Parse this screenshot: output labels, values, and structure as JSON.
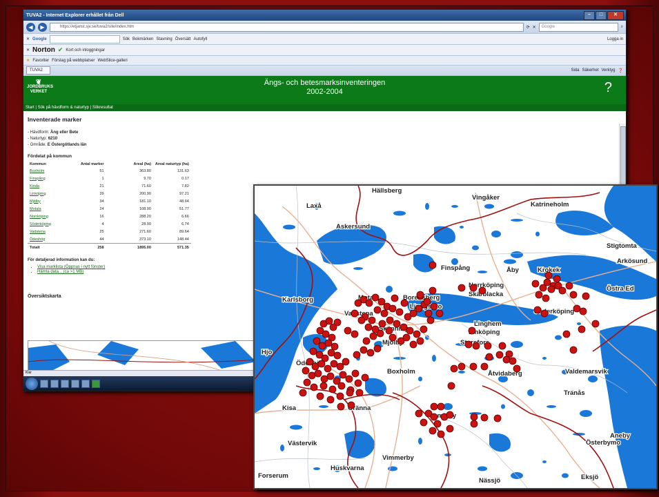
{
  "browser": {
    "window_title": "TUVA2 - Internet Explorer erhållet från Dell",
    "address": "https://etjanst.sjv.se/tuva2/site/index.htm",
    "search_placeholder": "Google",
    "google_label": "Google",
    "google_items": [
      "Sök",
      "Bokmärken",
      "Stavning",
      "Översätt",
      "Autofyll"
    ],
    "login_label": "Logga in",
    "norton_label": "Norton",
    "norton_item": "Kort och inloggningar",
    "favorites_label": "Favoriter",
    "favorites_items": [
      "Förslag på webbplatser",
      "WebSlice-galleri"
    ],
    "tab_label": "TUVA2",
    "toolbar_items": [
      "Sida",
      "Säkerhet",
      "Verktyg"
    ],
    "status_text": "Klar"
  },
  "page": {
    "logo_text": "JORDBRUKS VERKET",
    "title_line1": "Ängs- och betesmarksinventeringen",
    "title_line2": "2002-2004",
    "help_label": "?",
    "nav_text": "Start | Sök på hävdform & naturtyp | Sökresultat",
    "heading": "Inventerade marker",
    "criteria": [
      {
        "label": "- Hävdform: ",
        "value": "Äng eller Bete"
      },
      {
        "label": "- Naturtyp: ",
        "value": "6210"
      },
      {
        "label": "- Område: ",
        "value": "E Östergötlands län"
      }
    ],
    "table_title": "Fördelat på kommun",
    "columns": [
      "Kommun",
      "Antal marker",
      "Areal (ha)",
      "Areal naturtyp (ha)"
    ],
    "rows": [
      [
        "Boxholm",
        "51",
        "363.80",
        "131.63"
      ],
      [
        "Finspång",
        "1",
        "9.70",
        "0.17"
      ],
      [
        "Kinda",
        "21",
        "71.60",
        "7.82"
      ],
      [
        "Linköping",
        "39",
        "200.90",
        "97.21"
      ],
      [
        "Mjölby",
        "34",
        "181.10",
        "48.64"
      ],
      [
        "Motala",
        "24",
        "108.90",
        "51.77"
      ],
      [
        "Norrköping",
        "16",
        "288.20",
        "6.66"
      ],
      [
        "Söderköping",
        "4",
        "28.90",
        "6.74"
      ],
      [
        "Vadstena",
        "25",
        "271.60",
        "89.64"
      ],
      [
        "Ödeshög",
        "44",
        "373.10",
        "148.44"
      ]
    ],
    "total": [
      "Totalt",
      "258",
      "1895.00",
      "571.35"
    ],
    "more_info_title": "För detaljerad information kan du:",
    "more_info_links": [
      "Visa marklista (Öppnas i nytt fönster)",
      "Hämta data... (ca >1 MB)"
    ],
    "overview_title": "Översiktskarta"
  },
  "map": {
    "water_color": "#1a78d8",
    "marker_color": "#cc1111",
    "border_color": "#a01010",
    "place_labels": [
      "Hällsberg",
      "Vingåker",
      "Katrineholm",
      "Laxå",
      "Askersund",
      "Stigtomta",
      "Finspång",
      "Åby",
      "Krokek",
      "Arkösund",
      "Norrköping",
      "Skärblacka",
      "Östra Ed",
      "Motala",
      "Borensberg",
      "Ljungsbro",
      "Söderköping",
      "Karlsborg",
      "Vadstena",
      "Linghem",
      "Skänninge",
      "Linköping",
      "Mjölby",
      "Sturefors",
      "Hjo",
      "Ödeshög",
      "Boxholm",
      "Valdemarsvik",
      "Åtvidaberg",
      "Tranås",
      "Gränna",
      "Kisa",
      "Gamleby",
      "Aneby",
      "Österbymo",
      "Västervik",
      "Vimmerby",
      "Eksjö",
      "Nässjö",
      "Forserum",
      "Huskvarna"
    ]
  }
}
